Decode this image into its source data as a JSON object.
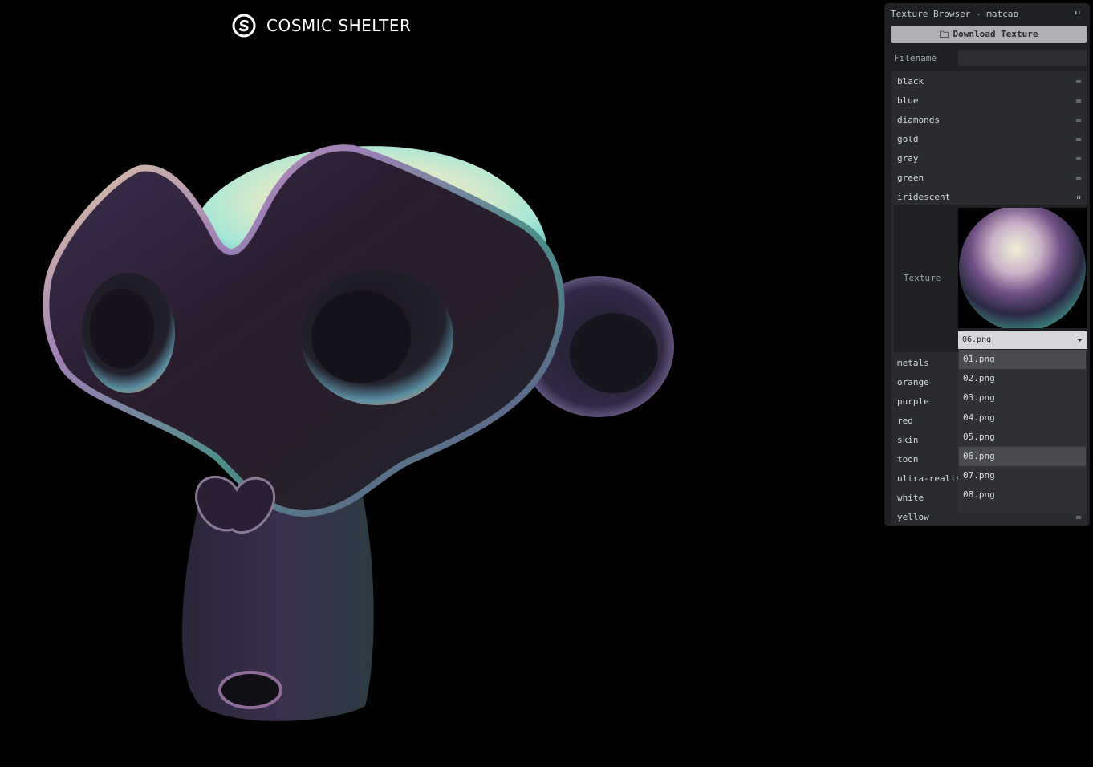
{
  "brand": {
    "name": "COSMIC SHELTER",
    "icon": "cosmic-shelter-logo-icon"
  },
  "panel": {
    "title": "Texture Browser - matcap",
    "download_label": "Download Texture",
    "filename_label": "Filename",
    "filename_value": "",
    "texture_label": "Texture",
    "folders_before": [
      "black",
      "blue",
      "diamonds",
      "gold",
      "gray",
      "green"
    ],
    "open_folder": "iridescent",
    "folders_after": [
      "metals",
      "orange",
      "purple",
      "red",
      "skin",
      "toon",
      "ultra-realistic",
      "white",
      "yellow"
    ],
    "selected_texture": "06.png",
    "options": [
      "01.png",
      "02.png",
      "03.png",
      "04.png",
      "05.png",
      "06.png",
      "07.png",
      "08.png"
    ]
  },
  "colors": {
    "background": "#000000",
    "panel": "#1f2024",
    "button": "#aeb0b5"
  }
}
